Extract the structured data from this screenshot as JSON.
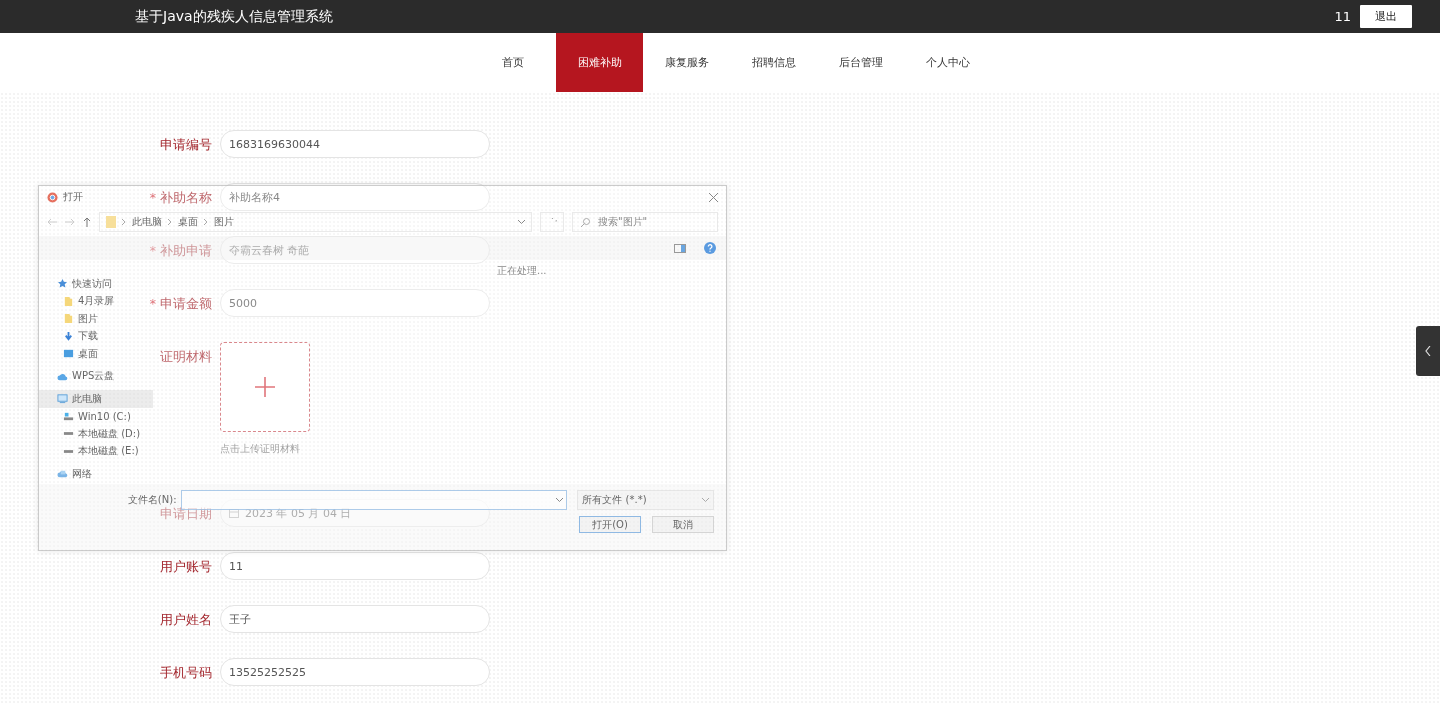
{
  "header": {
    "title": "基于Java的残疾人信息管理系统",
    "user": "11",
    "logout": "退出"
  },
  "nav": [
    {
      "label": "首页",
      "selected": false
    },
    {
      "label": "困难补助",
      "selected": true
    },
    {
      "label": "康复服务",
      "selected": false
    },
    {
      "label": "招聘信息",
      "selected": false
    },
    {
      "label": "后台管理",
      "selected": false
    },
    {
      "label": "个人中心",
      "selected": false
    }
  ],
  "form": {
    "fields": [
      {
        "kind": "input",
        "label": "申请编号",
        "value": "1683169630044"
      },
      {
        "kind": "input",
        "required_mark": "*",
        "label": "补助名称",
        "value": "补助名称4"
      },
      {
        "kind": "input",
        "required_mark": "*",
        "label": "补助申请",
        "value": "夺霸云春树 奇葩"
      },
      {
        "kind": "input",
        "required_mark": "*",
        "label": "申请金额",
        "value": "5000"
      },
      {
        "kind": "upload",
        "label": "证明材料",
        "hint": "点击上传证明材料"
      },
      {
        "kind": "date",
        "label": "申请日期",
        "value": "2023 年 05 月 04 日"
      },
      {
        "kind": "input",
        "label": "用户账号",
        "value": "11"
      },
      {
        "kind": "input",
        "label": "用户姓名",
        "value": "王子"
      },
      {
        "kind": "input",
        "label": "手机号码",
        "value": "13525252525"
      }
    ]
  },
  "dialog": {
    "title": "打开",
    "path": [
      "此电脑",
      "桌面",
      "图片"
    ],
    "search_placeholder": "搜索\"图片\"",
    "status": "正在处理...",
    "sidebar": [
      {
        "kind": "star",
        "label": "快速访问",
        "selected": false,
        "children": [
          {
            "kind": "folder",
            "label": "4月录屏",
            "selected": false
          },
          {
            "kind": "folder",
            "label": "图片",
            "selected": false
          },
          {
            "kind": "download",
            "label": "下载",
            "selected": false
          },
          {
            "kind": "desktop",
            "label": "桌面",
            "selected": false
          }
        ]
      },
      {
        "kind": "cloud",
        "label": "WPS云盘",
        "selected": false
      },
      {
        "kind": "computer",
        "label": "此电脑",
        "selected": true,
        "children": [
          {
            "kind": "system-drive",
            "label": "Win10 (C:)",
            "selected": false
          },
          {
            "kind": "drive",
            "label": "本地磁盘 (D:)",
            "selected": false
          },
          {
            "kind": "drive",
            "label": "本地磁盘 (E:)",
            "selected": false
          }
        ]
      },
      {
        "kind": "network",
        "label": "网络",
        "selected": false
      }
    ],
    "filename_label": "文件名(N):",
    "filetype": "所有文件 (*.*)",
    "buttons": [
      {
        "kind": "primary",
        "label": "打开(O)"
      },
      {
        "kind": "secondary",
        "label": "取消"
      }
    ]
  }
}
